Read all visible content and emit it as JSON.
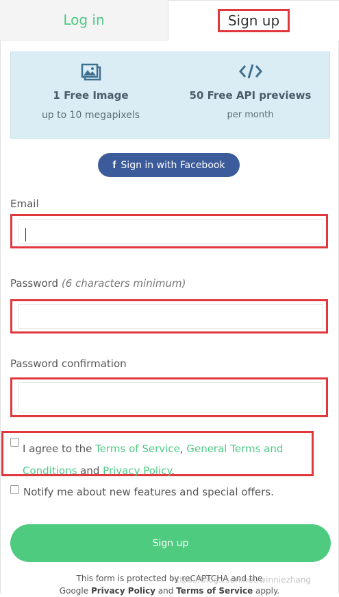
{
  "tabs": {
    "login": "Log in",
    "signup": "Sign up"
  },
  "info": {
    "left": {
      "icon": "image-icon",
      "title": "1 Free Image",
      "subtitle": "up to 10 megapixels"
    },
    "right": {
      "icon": "code-icon",
      "title": "50 Free API previews",
      "subtitle": "per month"
    }
  },
  "facebook_button": "Sign in with Facebook",
  "form": {
    "email_label": "Email",
    "password_label": "Password",
    "password_hint": "(6 characters minimum)",
    "confirm_label": "Password confirmation",
    "agree": {
      "prefix": "I agree to the ",
      "terms": "Terms of Service",
      "comma": ", ",
      "general_terms": "General Terms and Conditions",
      "and": " and ",
      "privacy": "Privacy Policy",
      "suffix": "."
    },
    "notify": "Notify me about new features and special offers.",
    "submit": "Sign up"
  },
  "recaptcha": {
    "line1": "This form is protected by reCAPTCHA and the",
    "line2_prefix": "Google ",
    "privacy": "Privacy Policy",
    "and": " and ",
    "terms": "Terms of Service",
    "suffix": " apply."
  },
  "watermark": "https://blog.csdn.net/winniezhang",
  "colors": {
    "accent": "#4ec985",
    "facebook": "#3c5b9a",
    "highlight": "#e0373d",
    "info_bg": "#daedf5"
  }
}
